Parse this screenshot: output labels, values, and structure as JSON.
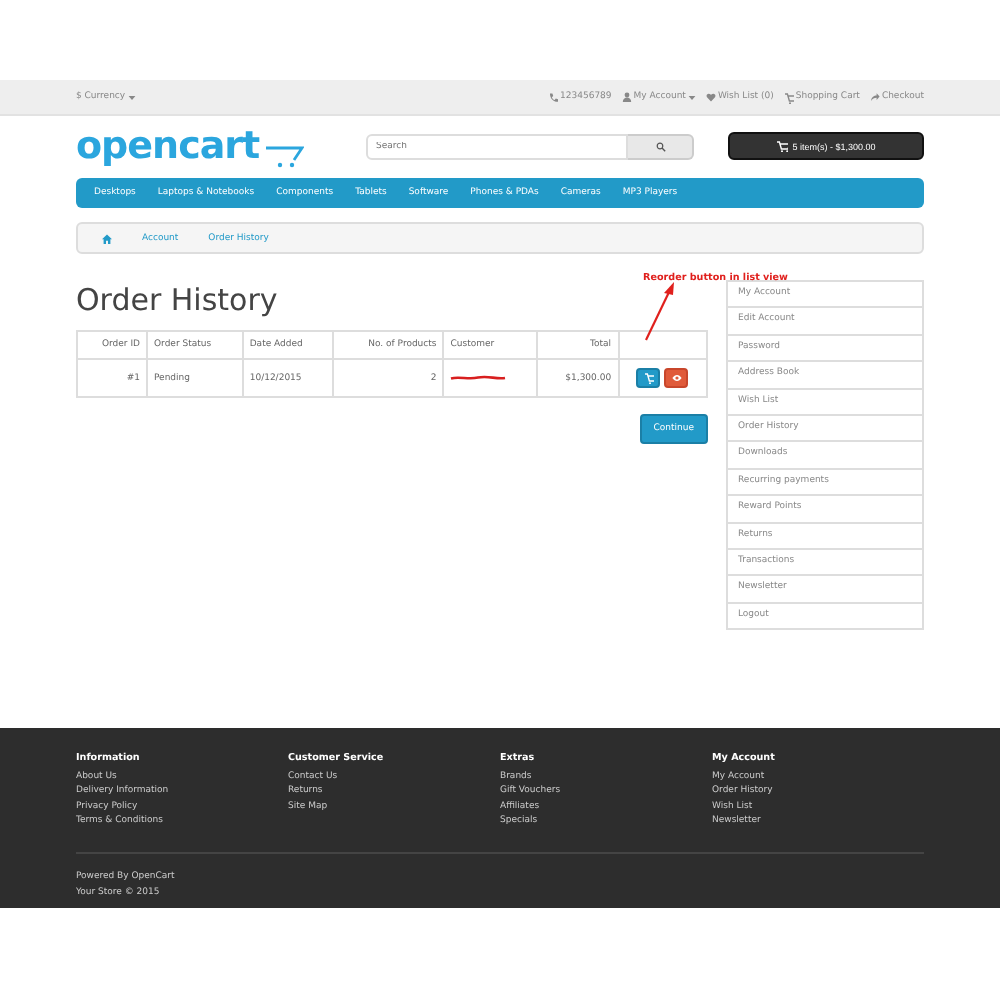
{
  "top_bar": {
    "currency": "$ Currency",
    "phone": "123456789",
    "links": [
      "My Account",
      "Wish List (0)",
      "Shopping Cart",
      "Checkout"
    ]
  },
  "header": {
    "logo": "opencart",
    "search": {
      "placeholder": "Search"
    },
    "cart": "5 item(s) - $1,300.00"
  },
  "menu": [
    "Desktops",
    "Laptops & Notebooks",
    "Components",
    "Tablets",
    "Software",
    "Phones & PDAs",
    "Cameras",
    "MP3 Players"
  ],
  "breadcrumb": [
    "Account",
    "Order History"
  ],
  "page_title": "Order History",
  "annotation": "Reorder button in list view",
  "table": {
    "columns": [
      "Order ID",
      "Order Status",
      "Date Added",
      "No. of Products",
      "Customer",
      "Total"
    ],
    "rows": [
      {
        "order_id": "#1",
        "status": "Pending",
        "date": "10/12/2015",
        "products": "2",
        "customer_redacted": true,
        "total": "$1,300.00"
      }
    ]
  },
  "continue_button": "Continue",
  "sidebar": {
    "items": [
      "My Account",
      "Edit Account",
      "Password",
      "Address Book",
      "Wish List",
      "Order History",
      "Downloads",
      "Recurring payments",
      "Reward Points",
      "Returns",
      "Transactions",
      "Newsletter",
      "Logout"
    ]
  },
  "footer": {
    "columns": [
      {
        "title": "Information",
        "links": [
          "About Us",
          "Delivery Information",
          "Privacy Policy",
          "Terms & Conditions"
        ]
      },
      {
        "title": "Customer Service",
        "links": [
          "Contact Us",
          "Returns",
          "Site Map"
        ]
      },
      {
        "title": "Extras",
        "links": [
          "Brands",
          "Gift Vouchers",
          "Affiliates",
          "Specials"
        ]
      },
      {
        "title": "My Account",
        "links": [
          "My Account",
          "Order History",
          "Wish List",
          "Newsletter"
        ]
      }
    ],
    "powered": "Powered By OpenCart",
    "copyright": "Your Store © 2015"
  }
}
